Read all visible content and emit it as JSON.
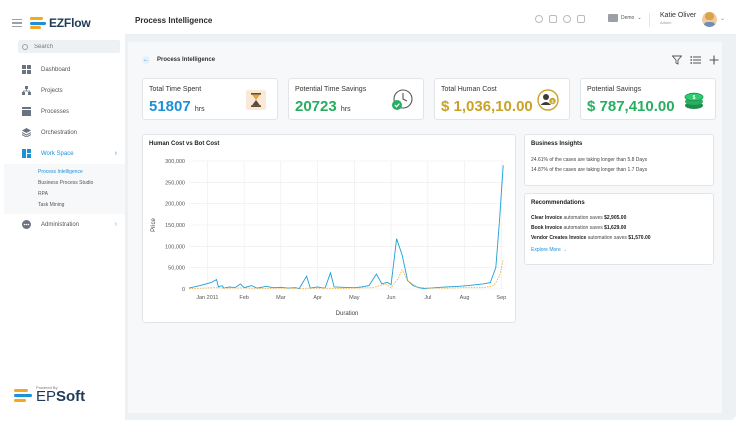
{
  "app": {
    "brand": "EZFlow",
    "brand_colors": {
      "orange": "#f5a623",
      "blue": "#1e90d6",
      "navy": "#1f3b57"
    },
    "powered_by": "Powered By",
    "powered_brand_a": "EP",
    "powered_brand_b": "Soft"
  },
  "sidebar": {
    "search_placeholder": "Search",
    "items": [
      {
        "label": "Dashboard",
        "icon": "grid-icon"
      },
      {
        "label": "Projects",
        "icon": "org-chart-icon"
      },
      {
        "label": "Processes",
        "icon": "layers-box-icon"
      },
      {
        "label": "Orchestration",
        "icon": "stack-icon"
      },
      {
        "label": "Work Space",
        "icon": "workspace-icon",
        "active": true
      },
      {
        "label": "Administration",
        "icon": "admin-icon"
      }
    ],
    "workspace_sub": [
      {
        "label": "Process Intelligence",
        "current": true
      },
      {
        "label": "Business Process Studio"
      },
      {
        "label": "RPA"
      },
      {
        "label": "Task Mining"
      }
    ]
  },
  "header": {
    "title": "Process Intelligence",
    "env": "Demo",
    "user_name": "Katie Oliver",
    "user_role": "Admin"
  },
  "breadcrumb": {
    "label": "Process Intelligence"
  },
  "stats": [
    {
      "label": "Total Time Spent",
      "value": "51807",
      "unit": "hrs",
      "color": "#1e90d6",
      "icon": "hourglass-icon"
    },
    {
      "label": "Potential Time Savings",
      "value": "20723",
      "unit": "hrs",
      "color": "#27ae60",
      "icon": "clock-check-icon"
    },
    {
      "label": "Total Human Cost",
      "value": "$ 1,036,10.00",
      "unit": "",
      "color": "#c9a227",
      "icon": "person-money-icon"
    },
    {
      "label": "Potential Savings",
      "value": "$ 787,410.00",
      "unit": "",
      "color": "#27ae60",
      "icon": "coins-icon"
    }
  ],
  "insights": {
    "title": "Business Insights",
    "lines": [
      "24.61% of the cases are taking longer than 5.8 Days",
      "14.87% of the cases are taking longer than 1.7 Days"
    ]
  },
  "recommendations": {
    "title": "Recommendations",
    "items": [
      {
        "name": "Clear Invoice",
        "text": " automation saves ",
        "amount": "$2,905.00"
      },
      {
        "name": "Book Invoice",
        "text": " automation saves ",
        "amount": "$1,629.00"
      },
      {
        "name": "Vendor Creates Invoice",
        "text": " automation saves ",
        "amount": "$1,570.00"
      }
    ],
    "explore": "Explore More →"
  },
  "chart_data": {
    "type": "line",
    "title": "Human Cost vs Bot Cost",
    "xlabel": "Duration",
    "ylabel": "Price",
    "ylim": [
      0,
      300000
    ],
    "yticks": [
      "300,000",
      "250,000",
      "200,000",
      "150,000",
      "100,000",
      "50,000",
      "0"
    ],
    "yvalues": [
      300000,
      250000,
      200000,
      150000,
      100000,
      50000,
      0
    ],
    "xticks": [
      "Jan 2011",
      "Feb",
      "Mar",
      "Apr",
      "May",
      "Jun",
      "Jul",
      "Aug",
      "Sep"
    ],
    "xmonths": [
      0,
      1,
      2,
      3,
      4,
      5,
      6,
      7,
      8
    ],
    "xlim": [
      -0.5,
      8.1
    ],
    "grid": true,
    "series": [
      {
        "color": "#1e9fd6",
        "dash": false,
        "points": [
          [
            -0.5,
            2000
          ],
          [
            -0.2,
            8000
          ],
          [
            0.1,
            15000
          ],
          [
            0.25,
            22000
          ],
          [
            0.3,
            5000
          ],
          [
            0.4,
            8000
          ],
          [
            0.45,
            2000
          ],
          [
            0.6,
            5000
          ],
          [
            0.75,
            3000
          ],
          [
            0.9,
            12000
          ],
          [
            1.0,
            3000
          ],
          [
            1.2,
            8000
          ],
          [
            1.35,
            2000
          ],
          [
            1.6,
            6000
          ],
          [
            1.8,
            3000
          ],
          [
            2.0,
            4000
          ],
          [
            2.2,
            2000
          ],
          [
            2.4,
            3000
          ],
          [
            2.5,
            1000
          ],
          [
            2.7,
            30000
          ],
          [
            2.8,
            2000
          ],
          [
            3.0,
            5000
          ],
          [
            3.1,
            3000
          ],
          [
            3.2,
            2000
          ],
          [
            3.35,
            38000
          ],
          [
            3.45,
            5000
          ],
          [
            3.7,
            4000
          ],
          [
            4.0,
            3000
          ],
          [
            4.2,
            5000
          ],
          [
            4.4,
            8000
          ],
          [
            4.6,
            35000
          ],
          [
            4.75,
            12000
          ],
          [
            4.9,
            16000
          ],
          [
            5.0,
            10000
          ],
          [
            5.15,
            118000
          ],
          [
            5.3,
            80000
          ],
          [
            5.45,
            20000
          ],
          [
            5.6,
            8000
          ],
          [
            5.75,
            3000
          ],
          [
            5.9,
            1000
          ],
          [
            6.2,
            3000
          ],
          [
            6.5,
            5000
          ],
          [
            6.8,
            6000
          ],
          [
            7.1,
            8000
          ],
          [
            7.5,
            12000
          ],
          [
            7.7,
            15000
          ],
          [
            7.85,
            50000
          ],
          [
            7.95,
            160000
          ],
          [
            8.05,
            290000
          ]
        ]
      },
      {
        "color": "#f0a830",
        "dash": true,
        "points": [
          [
            -0.5,
            1000
          ],
          [
            0.2,
            3000
          ],
          [
            0.5,
            2000
          ],
          [
            1.0,
            2500
          ],
          [
            1.5,
            1500
          ],
          [
            2.0,
            2000
          ],
          [
            2.5,
            1500
          ],
          [
            3.0,
            2000
          ],
          [
            3.5,
            1500
          ],
          [
            4.0,
            2000
          ],
          [
            4.5,
            3000
          ],
          [
            4.85,
            12000
          ],
          [
            5.0,
            3000
          ],
          [
            5.2,
            25000
          ],
          [
            5.3,
            45000
          ],
          [
            5.45,
            20000
          ],
          [
            5.7,
            5000
          ],
          [
            6.0,
            2000
          ],
          [
            6.5,
            2000
          ],
          [
            7.0,
            3000
          ],
          [
            7.5,
            3000
          ],
          [
            7.8,
            8000
          ],
          [
            7.95,
            30000
          ],
          [
            8.05,
            68000
          ]
        ]
      }
    ]
  }
}
